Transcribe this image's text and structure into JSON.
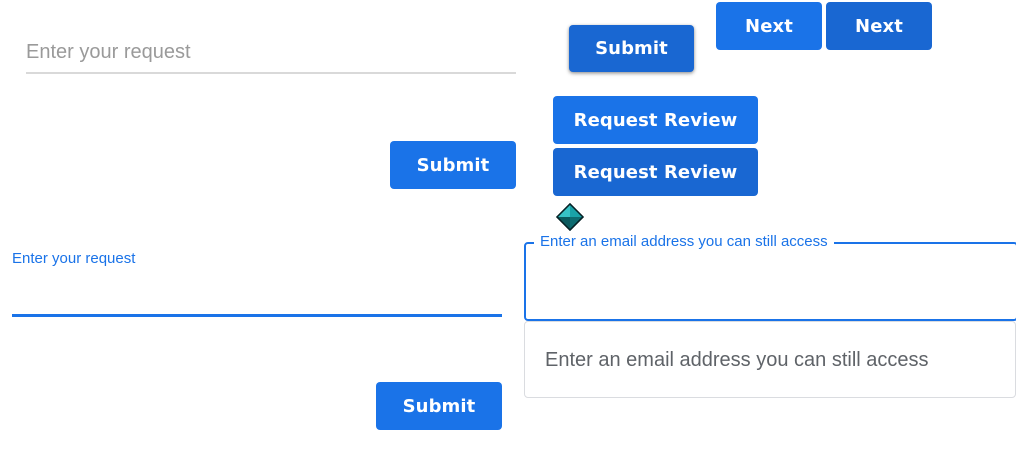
{
  "fields": {
    "request_top": {
      "placeholder": "Enter your request"
    },
    "request_focused": {
      "label": "Enter your request",
      "value": ""
    },
    "email_focused": {
      "label": "Enter an email address you can still access",
      "value": ""
    },
    "email_unfocused": {
      "placeholder": "Enter an email address you can still access"
    }
  },
  "buttons": {
    "submit_1": "Submit",
    "submit_2": "Submit",
    "submit_3": "Submit",
    "next_1": "Next",
    "next_2": "Next",
    "request_review_1": "Request Review",
    "request_review_2": "Request Review"
  },
  "icons": {
    "cursor": "diamond-cursor-icon"
  },
  "colors": {
    "primary": "#1a73e8",
    "primary_dark": "#1967d2",
    "placeholder": "#9a9a9a",
    "border": "#dadce0"
  }
}
